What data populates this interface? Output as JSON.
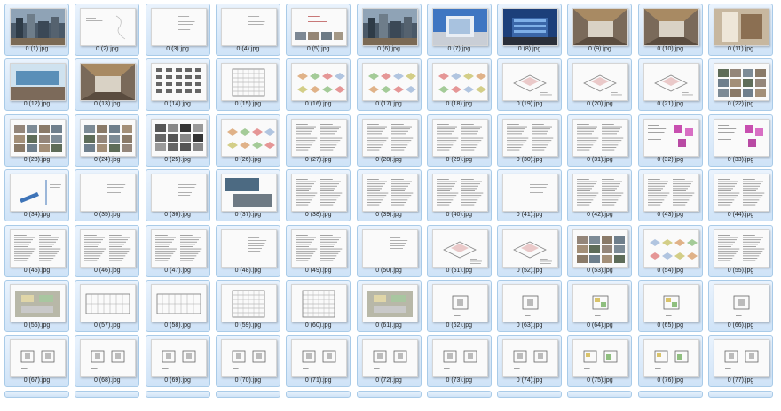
{
  "files": [
    {
      "name": "0 (1).jpg",
      "kind": "photo-city"
    },
    {
      "name": "0 (2).jpg",
      "kind": "sketch-page"
    },
    {
      "name": "0 (3).jpg",
      "kind": "text-sparse"
    },
    {
      "name": "0 (4).jpg",
      "kind": "text-sparse"
    },
    {
      "name": "0 (5).jpg",
      "kind": "photo-strip"
    },
    {
      "name": "0 (6).jpg",
      "kind": "photo-city"
    },
    {
      "name": "0 (7).jpg",
      "kind": "photo-building-blue"
    },
    {
      "name": "0 (8).jpg",
      "kind": "photo-building-night"
    },
    {
      "name": "0 (9).jpg",
      "kind": "photo-interior"
    },
    {
      "name": "0 (10).jpg",
      "kind": "photo-interior"
    },
    {
      "name": "0 (11).jpg",
      "kind": "photo-interior-light"
    },
    {
      "name": "0 (12).jpg",
      "kind": "photo-interior-blue"
    },
    {
      "name": "0 (13).jpg",
      "kind": "photo-interior"
    },
    {
      "name": "0 (14).jpg",
      "kind": "icons-grid"
    },
    {
      "name": "0 (15).jpg",
      "kind": "elevation"
    },
    {
      "name": "0 (16).jpg",
      "kind": "diagram-color"
    },
    {
      "name": "0 (17).jpg",
      "kind": "diagram-color"
    },
    {
      "name": "0 (18).jpg",
      "kind": "diagram-color"
    },
    {
      "name": "0 (19).jpg",
      "kind": "diagram-iso"
    },
    {
      "name": "0 (20).jpg",
      "kind": "diagram-iso"
    },
    {
      "name": "0 (21).jpg",
      "kind": "diagram-iso"
    },
    {
      "name": "0 (22).jpg",
      "kind": "photo-grid"
    },
    {
      "name": "0 (23).jpg",
      "kind": "photo-grid"
    },
    {
      "name": "0 (24).jpg",
      "kind": "photo-grid"
    },
    {
      "name": "0 (25).jpg",
      "kind": "photo-grid-bw"
    },
    {
      "name": "0 (26).jpg",
      "kind": "diagram-color"
    },
    {
      "name": "0 (27).jpg",
      "kind": "text-dense"
    },
    {
      "name": "0 (28).jpg",
      "kind": "text-dense"
    },
    {
      "name": "0 (29).jpg",
      "kind": "text-dense"
    },
    {
      "name": "0 (30).jpg",
      "kind": "text-dense"
    },
    {
      "name": "0 (31).jpg",
      "kind": "text-dense"
    },
    {
      "name": "0 (32).jpg",
      "kind": "diagram-magenta"
    },
    {
      "name": "0 (33).jpg",
      "kind": "diagram-magenta"
    },
    {
      "name": "0 (34).jpg",
      "kind": "diagram-blue"
    },
    {
      "name": "0 (35).jpg",
      "kind": "text-sparse"
    },
    {
      "name": "0 (36).jpg",
      "kind": "text-sparse"
    },
    {
      "name": "0 (37).jpg",
      "kind": "photo-pair"
    },
    {
      "name": "0 (38).jpg",
      "kind": "text-dense"
    },
    {
      "name": "0 (39).jpg",
      "kind": "text-dense"
    },
    {
      "name": "0 (40).jpg",
      "kind": "text-dense"
    },
    {
      "name": "0 (41).jpg",
      "kind": "text-sparse"
    },
    {
      "name": "0 (42).jpg",
      "kind": "text-dense"
    },
    {
      "name": "0 (43).jpg",
      "kind": "text-dense"
    },
    {
      "name": "0 (44).jpg",
      "kind": "text-dense"
    },
    {
      "name": "0 (45).jpg",
      "kind": "text-dense"
    },
    {
      "name": "0 (46).jpg",
      "kind": "text-dense"
    },
    {
      "name": "0 (47).jpg",
      "kind": "text-dense"
    },
    {
      "name": "0 (48).jpg",
      "kind": "text-sparse"
    },
    {
      "name": "0 (49).jpg",
      "kind": "text-dense"
    },
    {
      "name": "0 (50).jpg",
      "kind": "text-sparse"
    },
    {
      "name": "0 (51).jpg",
      "kind": "diagram-iso"
    },
    {
      "name": "0 (52).jpg",
      "kind": "diagram-iso"
    },
    {
      "name": "0 (53).jpg",
      "kind": "photo-grid"
    },
    {
      "name": "0 (54).jpg",
      "kind": "diagram-color"
    },
    {
      "name": "0 (55).jpg",
      "kind": "text-dense"
    },
    {
      "name": "0 (56).jpg",
      "kind": "plan-color"
    },
    {
      "name": "0 (57).jpg",
      "kind": "plan-line"
    },
    {
      "name": "0 (58).jpg",
      "kind": "plan-line"
    },
    {
      "name": "0 (59).jpg",
      "kind": "elevation"
    },
    {
      "name": "0 (60).jpg",
      "kind": "elevation"
    },
    {
      "name": "0 (61).jpg",
      "kind": "plan-color"
    },
    {
      "name": "0 (62).jpg",
      "kind": "plan-small"
    },
    {
      "name": "0 (63).jpg",
      "kind": "plan-small"
    },
    {
      "name": "0 (64).jpg",
      "kind": "plan-small-color"
    },
    {
      "name": "0 (65).jpg",
      "kind": "plan-small-color"
    },
    {
      "name": "0 (66).jpg",
      "kind": "plan-small"
    },
    {
      "name": "0 (67).jpg",
      "kind": "plan-pair"
    },
    {
      "name": "0 (68).jpg",
      "kind": "plan-pair"
    },
    {
      "name": "0 (69).jpg",
      "kind": "plan-pair"
    },
    {
      "name": "0 (70).jpg",
      "kind": "plan-pair"
    },
    {
      "name": "0 (71).jpg",
      "kind": "plan-pair"
    },
    {
      "name": "0 (72).jpg",
      "kind": "plan-pair"
    },
    {
      "name": "0 (73).jpg",
      "kind": "plan-pair"
    },
    {
      "name": "0 (74).jpg",
      "kind": "plan-pair"
    },
    {
      "name": "0 (75).jpg",
      "kind": "plan-pair-color"
    },
    {
      "name": "0 (76).jpg",
      "kind": "plan-pair-color"
    },
    {
      "name": "0 (77).jpg",
      "kind": "plan-pair"
    }
  ],
  "partial_row_count": 11,
  "colors": {
    "tile_border": "#a9cbe8",
    "tile_top": "#eaf3fd",
    "tile_bottom": "#cfe3f7",
    "caption": "#1f1f1f"
  }
}
